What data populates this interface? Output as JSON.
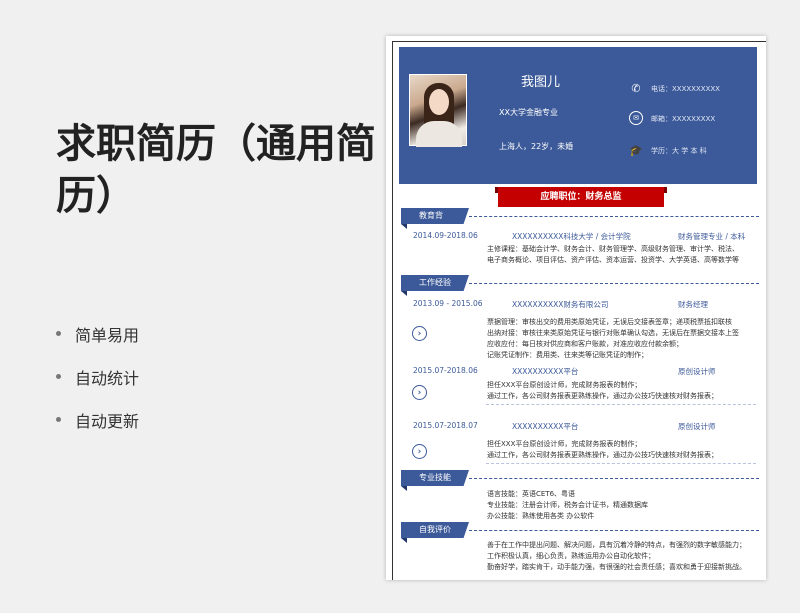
{
  "left": {
    "title": "求职简历（通用简历）",
    "bullets": [
      "简单易用",
      "自动统计",
      "自动更新"
    ]
  },
  "resume": {
    "name": "我图儿",
    "major": "XX大学金融专业",
    "info": "上海人，22岁，未婚",
    "phone": "电话：XXXXXXXXXX",
    "email": "邮箱：XXXXXXXXX",
    "degree": "学历：大 学 本 科",
    "icons": {
      "phone": "phone-icon",
      "email": "email-icon",
      "degree": "graduation-cap-icon"
    },
    "job": "应聘职位：财务总监",
    "sections": {
      "education": "教育背",
      "work": "工作经验",
      "skills": "专业技能",
      "self": "自我评价"
    },
    "education": {
      "date": "2014.09-2018.06",
      "school": "XXXXXXXXXX科技大学 / 会计学院",
      "degree": "财务管理专业 / 本科",
      "lines": [
        "主修课程：基础会计学、财务会计、财务管理学、高级财务管理、审计学、税法、",
        "电子商务概论、项目评估、资产评估、资本运营、投资学、大学英语、高等数学等"
      ]
    },
    "work": [
      {
        "date": "2013.09 - 2015.06",
        "company": "XXXXXXXXXX财务有限公司",
        "position": "财务经理",
        "lines": [
          "票据管理：审核出交的费用类原始凭证，无误后交接表签章；递项税票抵扣联核",
          "出纳对接：审核往来类原始凭证与银行对账单确认勾选，无误后在票据交接本上签",
          "应收应付：每日核对供应商和客户账款，对准应收应付款余额；",
          "记账凭证制作：费用类、往来类等记账凭证的制作；"
        ]
      },
      {
        "date": "2015.07-2018.06",
        "company": "XXXXXXXXXX平台",
        "position": "原创设计师",
        "lines": [
          "担任XXX平台原创设计师，完成财务报表的制作；",
          "通过工作，各公司财务报表更熟练操作，通过办公技巧快速核对财务报表；"
        ]
      },
      {
        "date": "2015.07-2018.07",
        "company": "XXXXXXXXXX平台",
        "position": "原创设计师",
        "lines": [
          "担任XXX平台原创设计师，完成财务报表的制作；",
          "通过工作，各公司财务报表更熟练操作，通过办公技巧快速核对财务报表；"
        ]
      }
    ],
    "skills": [
      "语言技能：英语CET6、粤语",
      "专业技能：注册会计师，税务会计证书，精通数据库",
      "办公技能：熟练使用各类 办公软件"
    ],
    "self": [
      "善于在工作中提出问题、解决问题，具有沉着冷静的特点，有强烈的数字敏感能力；",
      "工作积极认真，细心负责，熟练运用办公自动化软件；",
      "勤奋好学，踏实肯干，动手能力强，有很强的社会责任感；喜欢和勇于迎接新挑战。"
    ]
  }
}
